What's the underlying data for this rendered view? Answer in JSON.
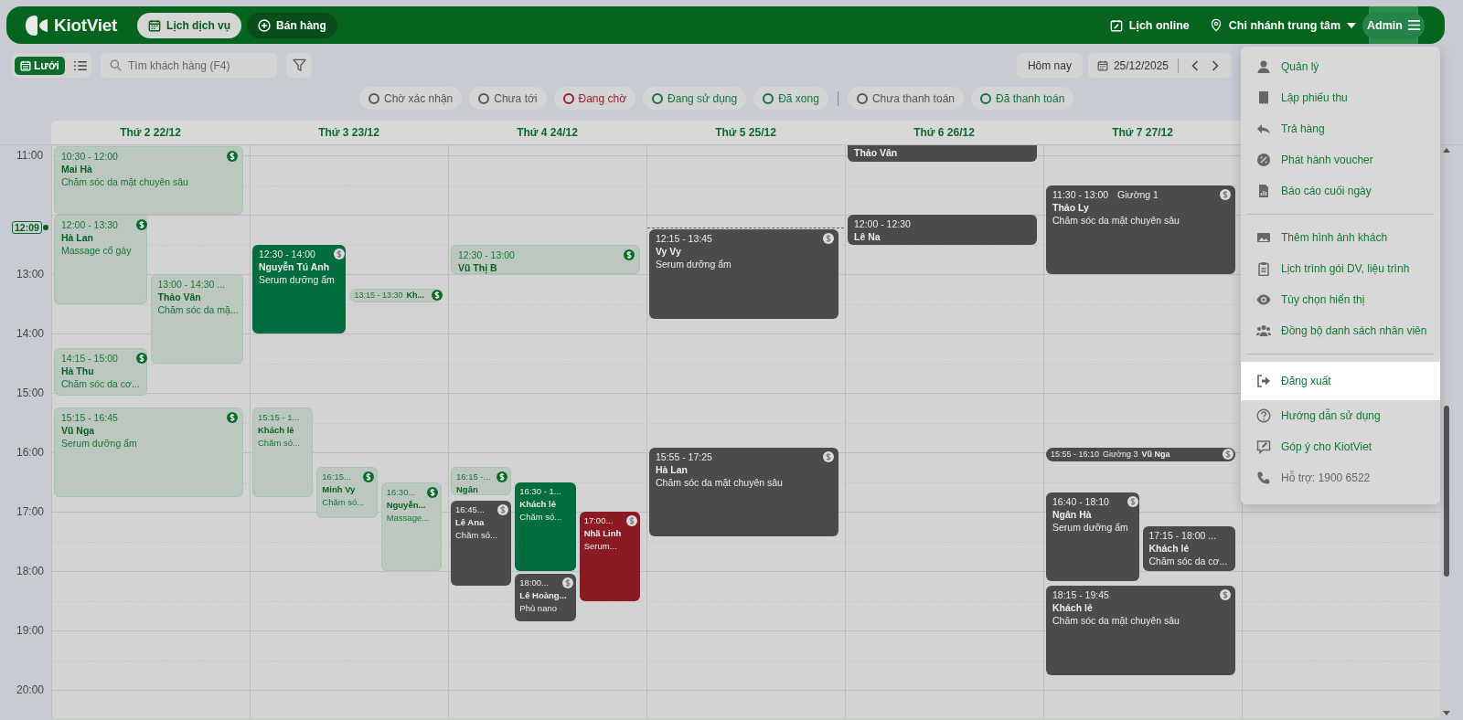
{
  "header": {
    "logo": "KiotViet",
    "tabs": [
      {
        "label": "Lịch dịch vụ",
        "selected": true
      },
      {
        "label": "Bán hàng",
        "selected": false
      }
    ],
    "online": "Lịch online",
    "branch": "Chi nhánh trung tâm",
    "user": "Admin"
  },
  "toolbar": {
    "views": [
      {
        "label": "Lưới",
        "selected": true
      },
      {
        "selected": false
      }
    ],
    "search": {
      "placeholder": "Tìm khách hàng (F4)"
    },
    "today": "Hôm nay",
    "date": "25/12/2025"
  },
  "appointment_filters": [
    {
      "label": "Chờ xác nhận",
      "color": "#555555"
    },
    {
      "label": "Chưa tới",
      "color": "#555555"
    },
    {
      "label": "Đang chờ",
      "color": "#9b1c2a"
    },
    {
      "label": "Đang sử dụng",
      "color": "#16723a"
    },
    {
      "label": "Đã xong",
      "color": "#16723a"
    }
  ],
  "payment_filters": [
    {
      "label": "Chưa thanh toán",
      "color": "#555555"
    },
    {
      "label": "Đã thanh toán",
      "color": "#16723a"
    }
  ],
  "time_labels": [
    "11:00",
    "13:00",
    "14:00",
    "15:00",
    "16:00",
    "17:00",
    "18:00",
    "19:00",
    "20:00"
  ],
  "now": "12:09",
  "days": [
    {
      "label": "Thứ 2 22/12",
      "today": false,
      "events": [
        {
          "kind": "card",
          "time": "10:30 - 12:00",
          "name": "Mai Hà",
          "service": "Chăm sóc da mặt chuyên sâu",
          "paid": true,
          "color": "#bcc8bf"
        },
        {
          "kind": "card",
          "time": "12:00 - 13:30",
          "name": "Hà Lan",
          "service": "Massage cổ gáy",
          "paid": true,
          "color": "#bcc8bf"
        },
        {
          "kind": "card",
          "time": "13:00 - 14:30 ...",
          "name": "Thảo Vân",
          "service": "Chăm sóc da mặ...",
          "paid": false,
          "color": "#bcc8bf"
        },
        {
          "kind": "card",
          "time": "14:15 - 15:00",
          "name": "Hà Thu",
          "service": "Chăm sóc da cơ...",
          "paid": true,
          "color": "#bcc8bf"
        },
        {
          "kind": "card",
          "time": "15:15 - 16:45",
          "name": "Vũ Nga",
          "service": "Serum dưỡng ẩm",
          "paid": true,
          "color": "#bcc8bf"
        }
      ]
    },
    {
      "label": "Thứ 3 23/12",
      "today": false,
      "events": [
        {
          "kind": "card",
          "time": "12:30 - 14:00",
          "name": "Nguyễn Tú Anh",
          "service": "Serum dưỡng ẩm",
          "paid": true,
          "color": "#006d3f"
        },
        {
          "kind": "compact",
          "time": "13:15 - 13:30",
          "name": "Kh...",
          "paid": true,
          "color": "#bcc8bf"
        },
        {
          "kind": "card",
          "time": "15:15 - 1...",
          "name": "Khách lẻ",
          "service": "Chăm só...",
          "paid": false,
          "color": "#bcc8bf"
        },
        {
          "kind": "card",
          "time": "16:15...",
          "name": "Minh Vy",
          "service": "Chăm só...",
          "paid": true,
          "color": "#bcc8bf"
        },
        {
          "kind": "card",
          "time": "16:30...",
          "name": "Nguyễn...",
          "service": "Massage...",
          "paid": true,
          "color": "#bcc8bf"
        }
      ]
    },
    {
      "label": "Thứ 4 24/12",
      "today": false,
      "events": [
        {
          "kind": "card",
          "time": "12:30 - 13:00",
          "name": "Vũ Thị B",
          "paid": true,
          "color": "#bcc8bf"
        },
        {
          "kind": "card",
          "time": "16:15 -...",
          "name": "Ngân",
          "paid": true,
          "color": "#bcc8bf"
        },
        {
          "kind": "card",
          "time": "16:45...",
          "name": "Lê Ana",
          "service": "Chăm só...",
          "paid": true,
          "color": "#4b4b4b"
        },
        {
          "kind": "card",
          "time": "16:30 - 1...",
          "name": "Khách lẻ",
          "service": "Chăm só...",
          "paid": false,
          "color": "#006d3f"
        },
        {
          "kind": "card",
          "time": "18:00...",
          "name": "Lê Hoàng...",
          "service": "Phủ nano",
          "paid": true,
          "color": "#4b4b4b"
        },
        {
          "kind": "card",
          "time": "17:00...",
          "name": "Nhã Linh",
          "service": "Serum...",
          "paid": true,
          "color": "#8c1a25"
        }
      ]
    },
    {
      "label": "Thứ 5 25/12",
      "today": true,
      "events": [
        {
          "kind": "card",
          "time": "12:15 - 13:45",
          "name": "Vy Vy",
          "service": "Serum dưỡng ẩm",
          "paid": true,
          "color": "#4b4b4b"
        },
        {
          "kind": "card",
          "time": "15:55 - 17:25",
          "name": "Hà Lan",
          "service": "Chăm sóc da mặt chuyên sâu",
          "paid": true,
          "color": "#4b4b4b"
        }
      ]
    },
    {
      "label": "Thứ 6 26/12",
      "today": false,
      "events": [
        {
          "kind": "card",
          "name": "Thảo Vân",
          "color": "#4b4b4b"
        },
        {
          "kind": "card",
          "time": "12:00 - 12:30",
          "name": "Lê Na",
          "paid": false,
          "color": "#4b4b4b"
        }
      ]
    },
    {
      "label": "Thứ 7 27/12",
      "today": false,
      "events": [
        {
          "kind": "card",
          "time": "11:30 - 13:00",
          "bed": "Giường 1",
          "name": "Thảo Ly",
          "service": "Chăm sóc da mặt chuyên sâu",
          "paid": true,
          "color": "#4b4b4b"
        },
        {
          "kind": "compact",
          "time": "15:55 - 16:10",
          "bed": "Giường 3",
          "name": "Vũ Nga",
          "paid": true,
          "color": "#4b4b4b"
        },
        {
          "kind": "card",
          "time": "16:40 - 18:10",
          "name": "Ngân Hà",
          "service": "Serum dưỡng ẩm",
          "paid": true,
          "color": "#4b4b4b"
        },
        {
          "kind": "card",
          "time": "17:15 - 18:00 ...",
          "name": "Khách lẻ",
          "service": "Chăm sóc da cơ...",
          "paid": false,
          "color": "#4b4b4b"
        },
        {
          "kind": "card",
          "time": "18:15 - 19:45",
          "name": "Khách lẻ",
          "service": "Chăm sóc da mặt chuyên sâu",
          "paid": true,
          "color": "#4b4b4b"
        }
      ]
    }
  ],
  "menu": {
    "groups": [
      [
        {
          "label": "Quản lý",
          "kind": "action",
          "selected": false
        },
        {
          "label": "Lập phiếu thu",
          "kind": "action",
          "selected": false
        },
        {
          "label": "Trả hàng",
          "kind": "action",
          "selected": false
        },
        {
          "label": "Phát hành voucher",
          "kind": "action",
          "selected": false
        },
        {
          "label": "Báo cáo cuối ngày",
          "kind": "action",
          "selected": false
        }
      ],
      [
        {
          "label": "Thêm hình ảnh khách",
          "kind": "action",
          "selected": false
        },
        {
          "label": "Lịch trình gói DV, liệu trình",
          "kind": "action",
          "selected": false
        },
        {
          "label": "Tùy chọn hiển thị",
          "kind": "action",
          "selected": false
        },
        {
          "label": "Đồng bộ danh sách nhân viên",
          "kind": "action",
          "selected": false
        }
      ],
      [
        {
          "label": "Đăng xuất",
          "kind": "action",
          "selected": true
        },
        {
          "label": "Hướng dẫn sử dụng",
          "kind": "action",
          "selected": false
        },
        {
          "label": "Góp ý cho KiotViet",
          "kind": "action",
          "selected": false
        },
        {
          "label": "Hỗ trợ: 1900 6522",
          "kind": "info",
          "selected": false
        }
      ]
    ]
  }
}
